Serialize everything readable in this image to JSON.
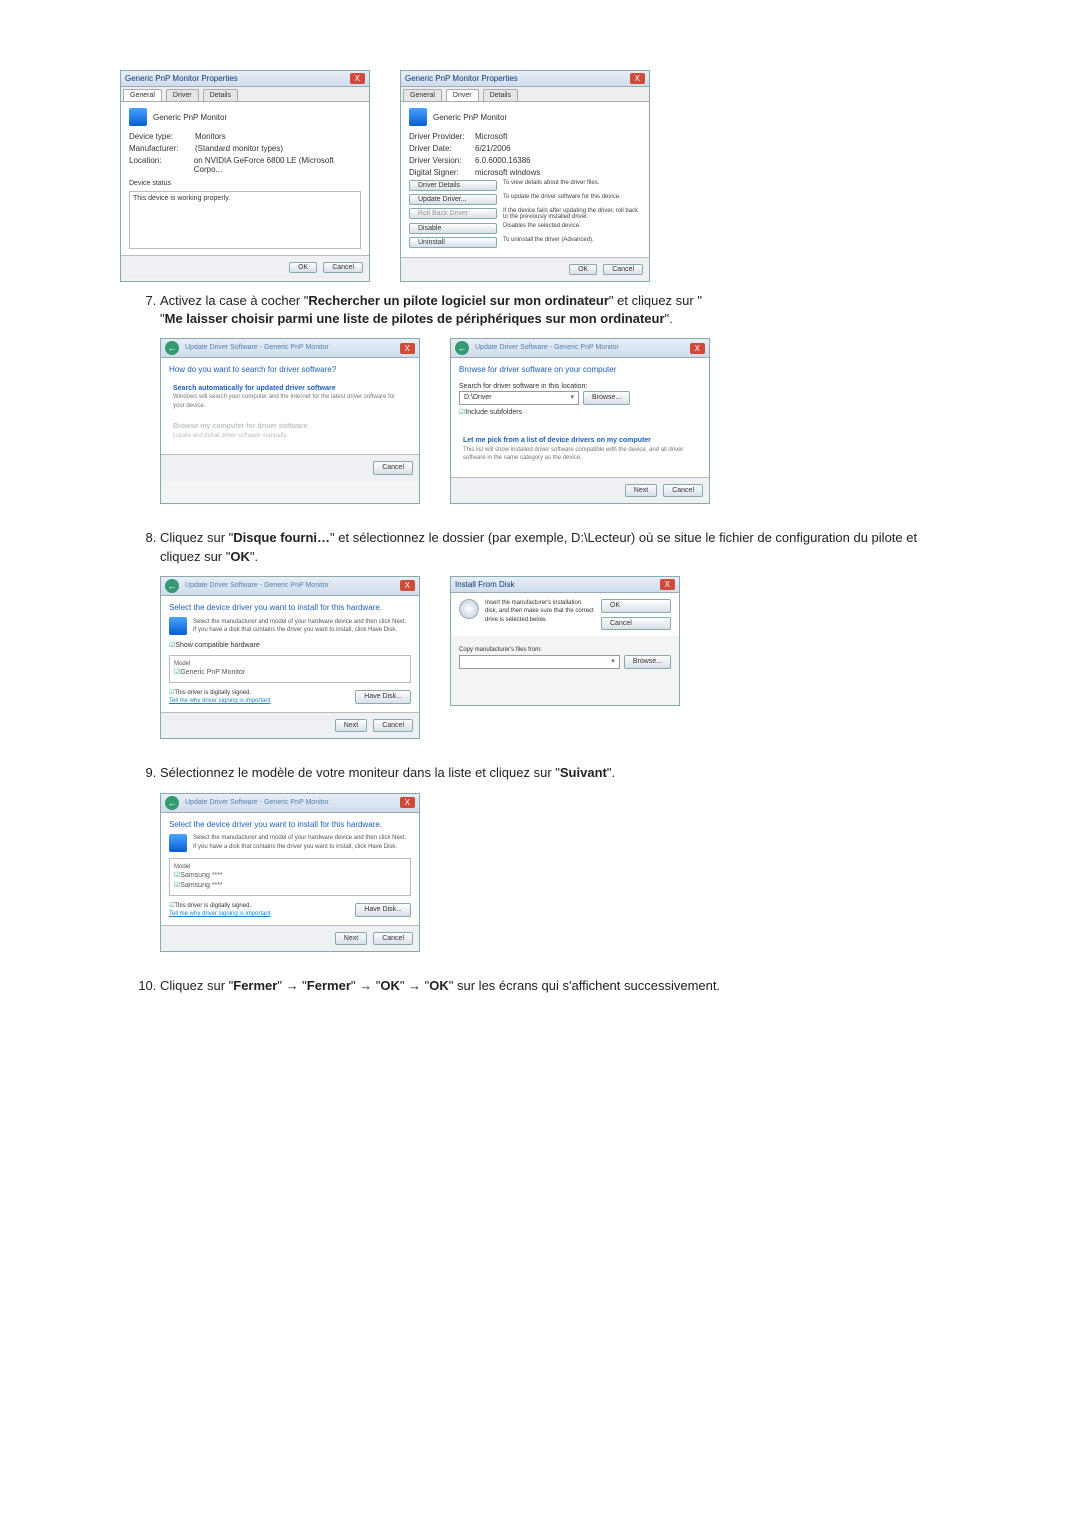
{
  "d1": {
    "title": "Generic PnP Monitor Properties",
    "tabs": [
      "General",
      "Driver",
      "Details"
    ],
    "header": "Generic PnP Monitor",
    "rows": {
      "type_l": "Device type:",
      "type_v": "Monitors",
      "mfr_l": "Manufacturer:",
      "mfr_v": "(Standard monitor types)",
      "loc_l": "Location:",
      "loc_v": "on NVIDIA GeForce 6800 LE (Microsoft Corpo..."
    },
    "status_l": "Device status",
    "status_v": "This device is working properly.",
    "ok": "OK",
    "cancel": "Cancel"
  },
  "d2": {
    "title": "Generic PnP Monitor Properties",
    "tabs": [
      "General",
      "Driver",
      "Details"
    ],
    "header": "Generic PnP Monitor",
    "rows": {
      "prov_l": "Driver Provider:",
      "prov_v": "Microsoft",
      "date_l": "Driver Date:",
      "date_v": "6/21/2006",
      "ver_l": "Driver Version:",
      "ver_v": "6.0.6000.16386",
      "sig_l": "Digital Signer:",
      "sig_v": "microsoft windows"
    },
    "btns": {
      "details": "Driver Details",
      "details_d": "To view details about the driver files.",
      "update": "Update Driver...",
      "update_d": "To update the driver software for this device.",
      "rollback": "Roll Back Driver",
      "rollback_d": "If the device fails after updating the driver, roll back to the previously installed driver.",
      "disable": "Disable",
      "disable_d": "Disables the selected device.",
      "uninst": "Uninstall",
      "uninst_d": "To uninstall the driver (Advanced)."
    },
    "ok": "OK",
    "cancel": "Cancel"
  },
  "step7": {
    "pre": "Activez la case à cocher \"",
    "b1": "Rechercher un pilote logiciel sur mon ordinateur",
    "mid": "\" et cliquez sur \"",
    "b2": "Me laisser choisir parmi une liste de pilotes de périphériques sur mon ordinateur",
    "end": "\"."
  },
  "d3": {
    "crumb": "Update Driver Software - Generic PnP Monitor",
    "q": "How do you want to search for driver software?",
    "opt1_t": "Search automatically for updated driver software",
    "opt1_s": "Windows will search your computer and the Internet for the latest driver software for your device.",
    "opt2_t": "Browse my computer for driver software",
    "opt2_s": "Locate and install driver software manually.",
    "cancel": "Cancel"
  },
  "d4": {
    "crumb": "Update Driver Software - Generic PnP Monitor",
    "h": "Browse for driver software on your computer",
    "search_l": "Search for driver software in this location:",
    "path": "D:\\Driver",
    "browse": "Browse...",
    "sub_cb": "Include subfolders",
    "opt_t": "Let me pick from a list of device drivers on my computer",
    "opt_s": "This list will show installed driver software compatible with the device, and all driver software in the same category as the device.",
    "next": "Next",
    "cancel": "Cancel"
  },
  "step8": {
    "pre": "Cliquez sur \"",
    "b1": "Disque fourni…",
    "mid": "\" et sélectionnez le dossier (par exemple, D:\\Lecteur) où se situe le fichier de configuration du pilote et cliquez sur \"",
    "b2": "OK",
    "end": "\"."
  },
  "d5": {
    "crumb": "Update Driver Software - Generic PnP Monitor",
    "h": "Select the device driver you want to install for this hardware.",
    "sub": "Select the manufacturer and model of your hardware device and then click Next. If you have a disk that contains the driver you want to install, click Have Disk.",
    "cb": "Show compatible hardware",
    "model_h": "Model",
    "model_v": "Generic PnP Monitor",
    "signed": "This driver is digitally signed.",
    "why": "Tell me why driver signing is important",
    "havedisk": "Have Disk...",
    "next": "Next",
    "cancel": "Cancel"
  },
  "d6": {
    "title": "Install From Disk",
    "msg": "Insert the manufacturer's installation disk, and then make sure that the correct drive is selected below.",
    "copy_l": "Copy manufacturer's files from:",
    "ok": "OK",
    "cancel": "Cancel",
    "browse": "Browse..."
  },
  "step9": {
    "pre": "Sélectionnez le modèle de votre moniteur dans la liste et cliquez sur \"",
    "b1": "Suivant",
    "end": "\"."
  },
  "d7": {
    "crumb": "Update Driver Software - Generic PnP Monitor",
    "h": "Select the device driver you want to install for this hardware.",
    "sub": "Select the manufacturer and model of your hardware device and then click Next. If you have a disk that contains the driver you want to install, click Have Disk.",
    "model_h": "Model",
    "m1": "Samsung ****",
    "m2": "Samsung ****",
    "signed": "This driver is digitally signed.",
    "why": "Tell me why driver signing is important",
    "havedisk": "Have Disk...",
    "next": "Next",
    "cancel": "Cancel"
  },
  "step10": {
    "pre": "Cliquez sur \"",
    "b1": "Fermer",
    "a1": "\" → \"",
    "b2": "Fermer",
    "a2": "\" → \"",
    "b3": "OK",
    "a3": "\" → \"",
    "b4": "OK",
    "end": "\" sur les écrans qui s'affichent successivement."
  }
}
